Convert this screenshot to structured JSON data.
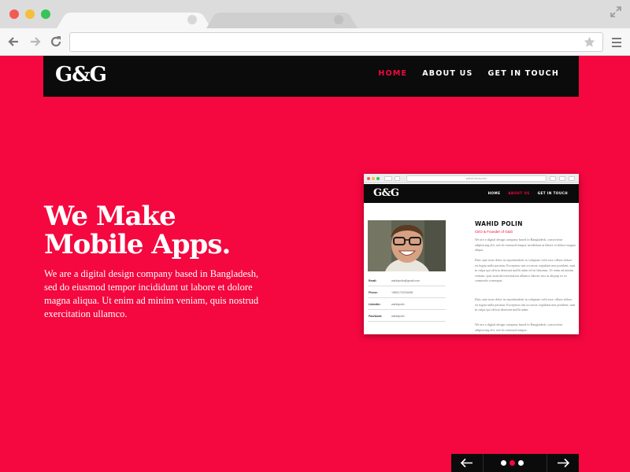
{
  "browser": {
    "url": "",
    "tabs": [
      {
        "label": "",
        "active": true
      },
      {
        "label": "",
        "active": false
      }
    ]
  },
  "site": {
    "logo": "G&G",
    "nav": [
      {
        "label": "HOME",
        "active": true
      },
      {
        "label": "ABOUT US",
        "active": false
      },
      {
        "label": "GET IN TOUCH",
        "active": false
      }
    ]
  },
  "hero": {
    "title_line1": "We Make",
    "title_line2": "Mobile Apps.",
    "body": "We are a digital design company based in Bangladesh, sed do eiusmod tempor incididunt ut labore et dolore magna aliqua. Ut enim ad minim veniam, quis nostrud exercitation ullamco."
  },
  "mockup": {
    "url": "wahid-lloma.com",
    "logo": "G&G",
    "nav": [
      "HOME",
      "ABOUT US",
      "GET IN TOUCH"
    ],
    "name": "WAHID POLIN",
    "role": "CEO & Founder of G&G",
    "paragraphs": [
      "We are a digital design company based in Bangladesh, consectetur adipisicing elit, sed do eiusmod tempor incididunt ut labore et dolore magna aliqua.",
      "Duis aute irure dolor in reprehenderit in voluptate velit esse cillum dolore eu fugiat nulla pariatur. Excepteur sint occaecat cupidatat non proident, sunt in culpa qui officia deserunt mollit anim id est laborum. Ut enim ad minim veniam, quis nostrud exercitation ullamco laboris nisi ut aliquip ex ea commodo consequat.",
      "Duis aute irure dolor in reprehenderit in voluptate velit esse cillum dolore eu fugiat nulla pariatur. Excepteur sint occaecat cupidatat non proident, sunt in culpa qui officia deserunt mollit anim.",
      "We are a digital design company based in Bangladesh, consectetur adipisicing elit, sed do eiusmod tempor."
    ],
    "contact": [
      {
        "label": "Email:",
        "value": "wahidpolin@gmail.com"
      },
      {
        "label": "Phone:",
        "value": "+8801722334455"
      },
      {
        "label": "LinkedIn:",
        "value": "wahidpolin"
      },
      {
        "label": "Facebook:",
        "value": "wahidpolin"
      }
    ]
  },
  "slider": {
    "prev_icon": "arrow-left-icon",
    "next_icon": "arrow-right-icon",
    "active_index": 1,
    "count": 3
  },
  "colors": {
    "brand_red": "#f5073f",
    "header_black": "#0b0b0b"
  }
}
